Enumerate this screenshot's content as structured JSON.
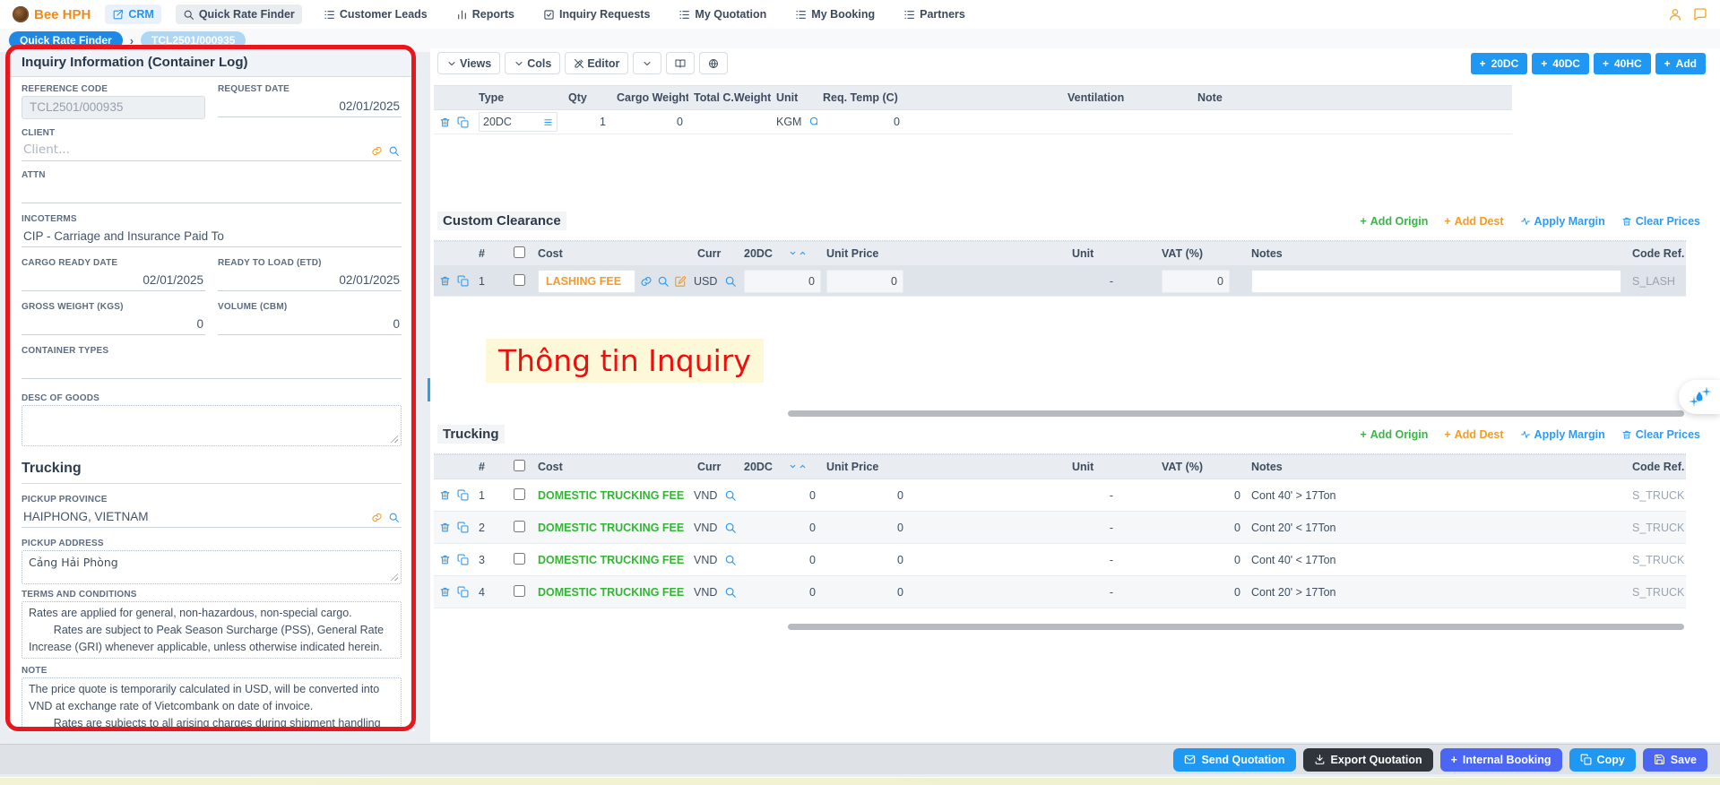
{
  "colors": {
    "accent_blue": "#1f98f4",
    "brand_orange": "#ef8b1d",
    "link_green": "#3bb44a",
    "link_orange": "#f59b25",
    "annotation_red": "#ef0e0e",
    "annotation_bg": "#fdf9d8",
    "indigo": "#4a66f2",
    "dark_button": "#30353c",
    "selected_row": "#dfe3ea"
  },
  "topnav": {
    "brand": "Bee HPH",
    "items": [
      {
        "label": "CRM"
      },
      {
        "label": "Quick Rate Finder"
      },
      {
        "label": "Customer Leads"
      },
      {
        "label": "Reports"
      },
      {
        "label": "Inquiry Requests"
      },
      {
        "label": "My Quotation"
      },
      {
        "label": "My Booking"
      },
      {
        "label": "Partners"
      }
    ]
  },
  "breadcrumb": {
    "root": "Quick Rate Finder",
    "separator": "›",
    "current": "TCL2501/000935"
  },
  "panel": {
    "title": "Inquiry Information (Container Log)",
    "reference_code": {
      "label": "REFERENCE CODE",
      "value": "TCL2501/000935"
    },
    "request_date": {
      "label": "REQUEST DATE",
      "value": "02/01/2025"
    },
    "client": {
      "label": "CLIENT",
      "placeholder": "Client..."
    },
    "attn": {
      "label": "ATTN",
      "value": ""
    },
    "incoterms": {
      "label": "INCOTERMS",
      "value": "CIP - Carriage and Insurance Paid To"
    },
    "cargo_ready_date": {
      "label": "CARGO READY DATE",
      "value": "02/01/2025"
    },
    "ready_to_load": {
      "label": "READY TO LOAD (ETD)",
      "value": "02/01/2025"
    },
    "gross_weight": {
      "label": "GROSS WEIGHT (KGS)",
      "value": "0"
    },
    "volume": {
      "label": "VOLUME (CBM)",
      "value": "0"
    },
    "container_types": {
      "label": "CONTAINER TYPES",
      "value": ""
    },
    "desc_of_goods": {
      "label": "DESC OF GOODS",
      "value": ""
    },
    "trucking_heading": "Trucking",
    "pickup_province": {
      "label": "PICKUP PROVINCE",
      "value": "HAIPHONG, VIETNAM"
    },
    "pickup_address": {
      "label": "PICKUP ADDRESS",
      "value": "Cảng Hải Phòng"
    },
    "terms": {
      "label": "TERMS AND CONDITIONS",
      "value": "Rates are applied for general, non-hazardous, non-special cargo.\n        Rates are subject to Peak Season Surcharge (PSS), General Rate Increase (GRI) whenever applicable, unless otherwise indicated herein."
    },
    "note": {
      "label": "NOTE",
      "value": "The price quote is temporarily calculated in USD, will be converted into VND at exchange rate of Vietcombank on date of invoice.\n        Rates are subjects to all arising charges during shipment handling"
    }
  },
  "toolbar": {
    "views": "Views",
    "cols": "Cols",
    "editor": "Editor",
    "add_20dc": "20DC",
    "add_40dc": "40DC",
    "add_40hc": "40HC",
    "add": "Add"
  },
  "container_table": {
    "headers": {
      "type": "Type",
      "qty": "Qty",
      "cargo_weight": "Cargo Weight",
      "total_cweight": "Total C.Weight",
      "unit": "Unit",
      "req_temp": "Req. Temp (C)",
      "ventilation": "Ventilation",
      "note": "Note"
    },
    "row": {
      "type": "20DC",
      "qty": "1",
      "cargo_weight": "0",
      "total_cweight": "",
      "unit": "KGM",
      "req_temp": "0",
      "ventilation": "",
      "note": ""
    }
  },
  "section_actions": {
    "add_origin": "Add Origin",
    "add_dest": "Add Dest",
    "apply_margin": "Apply Margin",
    "clear_prices": "Clear Prices"
  },
  "cost_headers": {
    "num": "#",
    "cost": "Cost",
    "curr": "Curr",
    "dc20": "20DC",
    "unit_price": "Unit Price",
    "unit": "Unit",
    "vat": "VAT (%)",
    "notes": "Notes",
    "code_ref": "Code Ref."
  },
  "custom_clearance": {
    "title": "Custom Clearance",
    "rows": [
      {
        "num": "1",
        "cost": "LASHING FEE",
        "curr": "USD",
        "dc20": "0",
        "unit_price": "0",
        "unit": "-",
        "vat": "0",
        "notes": "",
        "code_ref": "S_LASH"
      }
    ]
  },
  "annotation": {
    "text": "Thông tin Inquiry"
  },
  "trucking": {
    "title": "Trucking",
    "rows": [
      {
        "num": "1",
        "cost": "DOMESTIC TRUCKING FEE",
        "curr": "VND",
        "dc20": "0",
        "unit_price": "0",
        "unit": "-",
        "vat": "0",
        "notes": "Cont 40' > 17Ton",
        "code_ref": "S_TRUCK"
      },
      {
        "num": "2",
        "cost": "DOMESTIC TRUCKING FEE",
        "curr": "VND",
        "dc20": "0",
        "unit_price": "0",
        "unit": "-",
        "vat": "0",
        "notes": "Cont 20' < 17Ton",
        "code_ref": "S_TRUCK"
      },
      {
        "num": "3",
        "cost": "DOMESTIC TRUCKING FEE",
        "curr": "VND",
        "dc20": "0",
        "unit_price": "0",
        "unit": "-",
        "vat": "0",
        "notes": "Cont 40' < 17Ton",
        "code_ref": "S_TRUCK"
      },
      {
        "num": "4",
        "cost": "DOMESTIC TRUCKING FEE",
        "curr": "VND",
        "dc20": "0",
        "unit_price": "0",
        "unit": "-",
        "vat": "0",
        "notes": "Cont 20' > 17Ton",
        "code_ref": "S_TRUCK"
      }
    ]
  },
  "footer": {
    "send_quotation": "Send Quotation",
    "export_quotation": "Export Quotation",
    "internal_booking": "Internal Booking",
    "copy": "Copy",
    "save": "Save"
  }
}
